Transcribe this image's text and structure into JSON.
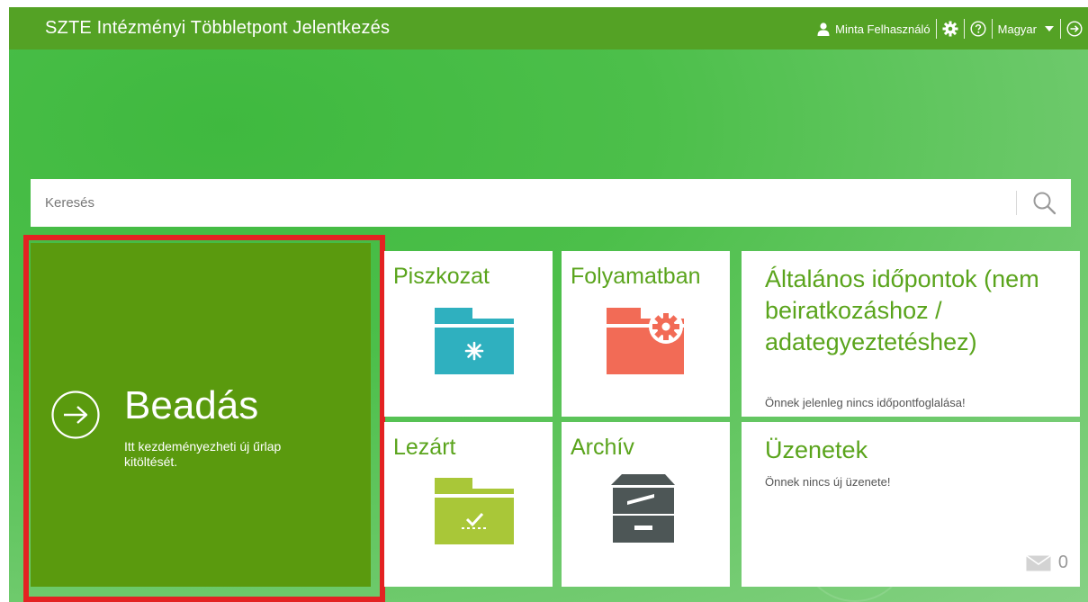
{
  "header": {
    "title": "SZTE Intézményi Többletpont Jelentkezés",
    "user_name": "Minta Felhasználó",
    "language": "Magyar"
  },
  "search": {
    "placeholder": "Keresés"
  },
  "beadas": {
    "title": "Beadás",
    "subtitle": "Itt kezdeményezheti új űrlap kitöltését."
  },
  "tiles": {
    "piszkozat": {
      "label": "Piszkozat"
    },
    "folyamatban": {
      "label": "Folyamatban"
    },
    "lezart": {
      "label": "Lezárt"
    },
    "archiv": {
      "label": "Archív"
    }
  },
  "appointments": {
    "title": "Általános időpontok (nem beiratkozáshoz / adategyeztetéshez)",
    "note": "Önnek jelenleg nincs időpontfoglalása!"
  },
  "messages": {
    "title": "Üzenetek",
    "note": "Önnek nincs új üzenete!",
    "count": "0"
  },
  "colors": {
    "topbar": "#54a225",
    "beadas_tile": "#5a9a0e",
    "highlight_frame": "#e32222",
    "tile_title": "#5aa41c",
    "piszkozat_icon": "#2fb0bf",
    "folyamatban_icon": "#f26b56",
    "lezart_icon": "#a9c738",
    "archiv_icon": "#4d5656"
  }
}
